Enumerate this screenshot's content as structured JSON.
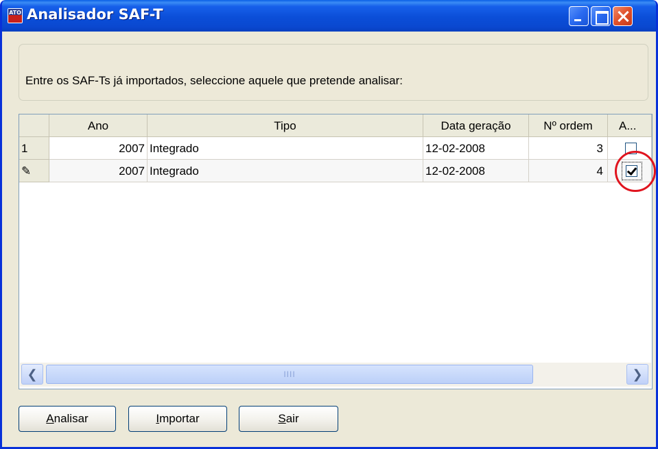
{
  "window": {
    "title": "Analisador SAF-T",
    "icon": "app-logo-icon",
    "controls": [
      "minimize-icon",
      "maximize-icon",
      "close-icon"
    ]
  },
  "instruction": "Entre os SAF-Ts já importados, seleccione aquele que pretende analisar:",
  "grid": {
    "columns": [
      "Ano",
      "Tipo",
      "Data geração",
      "Nº ordem",
      "A..."
    ],
    "rows": [
      {
        "indicator": "1",
        "ano": "2007",
        "tipo": "Integrado",
        "data": "12-02-2008",
        "ordem": "3",
        "checked": false
      },
      {
        "indicator": "✎",
        "ano": "2007",
        "tipo": "Integrado",
        "data": "12-02-2008",
        "ordem": "4",
        "checked": true
      }
    ],
    "scroll_grip": "IIII"
  },
  "buttons": {
    "analisar_first": "A",
    "analisar_rest": "nalisar",
    "importar_first": "I",
    "importar_rest": "mportar",
    "sair_first": "S",
    "sair_rest": "air"
  },
  "colors": {
    "titlebar": "#0a48d0",
    "highlight_circle": "#e0141e"
  }
}
